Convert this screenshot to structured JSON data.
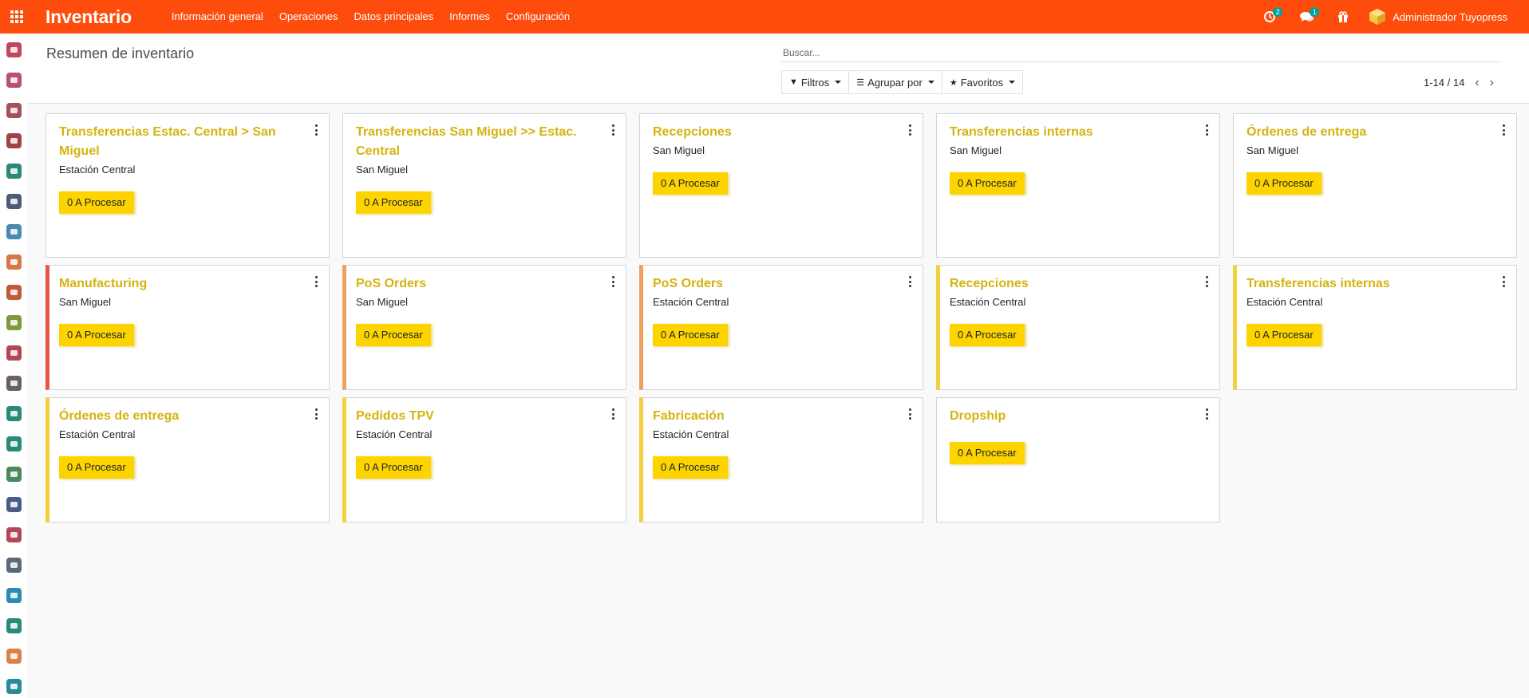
{
  "navbar": {
    "app_title": "Inventario",
    "menu": [
      "Información general",
      "Operaciones",
      "Datos principales",
      "Informes",
      "Configuración"
    ],
    "activity_badge": "2",
    "messages_badge": "1",
    "user_name": "Administrador Tuyopress",
    "color": "#fd4c0b"
  },
  "sidebar": {
    "icons": [
      {
        "name": "discuss-icon",
        "color": "#c0475e"
      },
      {
        "name": "gift-icon",
        "color": "#b7536e"
      },
      {
        "name": "chart-icon",
        "color": "#a6505c"
      },
      {
        "name": "inventory-icon",
        "color": "#a3414a"
      },
      {
        "name": "contacts-icon",
        "color": "#2a8a79"
      },
      {
        "name": "crm-icon",
        "color": "#4e5a7a"
      },
      {
        "name": "accounting-icon",
        "color": "#4a8ab0"
      },
      {
        "name": "invoice-icon",
        "color": "#d6784a"
      },
      {
        "name": "website-icon",
        "color": "#c25a3a"
      },
      {
        "name": "calendar-icon",
        "color": "#7f9a3a"
      },
      {
        "name": "delivery-icon",
        "color": "#b3475a"
      },
      {
        "name": "pos-icon",
        "color": "#6b5f6b"
      },
      {
        "name": "employees-icon",
        "color": "#2a8a79"
      },
      {
        "name": "settings-icon",
        "color": "#2a8a79"
      },
      {
        "name": "manufacturing-icon",
        "color": "#4a8a5a"
      },
      {
        "name": "apps-icon",
        "color": "#4a5a8a"
      },
      {
        "name": "timesheet-icon",
        "color": "#b3475a"
      },
      {
        "name": "email-marketing-icon",
        "color": "#5a6a7a"
      },
      {
        "name": "documents-icon",
        "color": "#2a8ab0"
      },
      {
        "name": "sales-icon",
        "color": "#2a8a79"
      },
      {
        "name": "survey-icon",
        "color": "#d6844a"
      },
      {
        "name": "team-icon",
        "color": "#2a8a9a"
      }
    ]
  },
  "control": {
    "title": "Resumen de inventario",
    "search_placeholder": "Buscar...",
    "filters_label": "Filtros",
    "groupby_label": "Agrupar por",
    "favorites_label": "Favoritos",
    "pager": "1-14 / 14"
  },
  "cards": [
    {
      "title": "Transferencias Estac. Central > San Miguel",
      "subtitle": "Estación Central",
      "button": "0 A Procesar",
      "bar": "none",
      "has_menu": true
    },
    {
      "title": "Transferencias San Miguel >> Estac. Central",
      "subtitle": "San Miguel",
      "button": "0 A Procesar",
      "bar": "none",
      "has_menu": true
    },
    {
      "title": "Recepciones",
      "subtitle": "San Miguel",
      "button": "0 A Procesar",
      "bar": "none",
      "has_menu": true
    },
    {
      "title": "Transferencias internas",
      "subtitle": "San Miguel",
      "button": "0 A Procesar",
      "bar": "none",
      "has_menu": true
    },
    {
      "title": "Órdenes de entrega",
      "subtitle": "San Miguel",
      "button": "0 A Procesar",
      "bar": "none",
      "has_menu": true
    },
    {
      "title": "Manufacturing",
      "subtitle": "San Miguel",
      "button": "0 A Procesar",
      "bar": "red",
      "has_menu": true
    },
    {
      "title": "PoS Orders",
      "subtitle": "San Miguel",
      "button": "0 A Procesar",
      "bar": "orange",
      "has_menu": true
    },
    {
      "title": "PoS Orders",
      "subtitle": "Estación Central",
      "button": "0 A Procesar",
      "bar": "orange",
      "has_menu": true
    },
    {
      "title": "Recepciones",
      "subtitle": "Estación Central",
      "button": "0 A Procesar",
      "bar": "yellow",
      "has_menu": true
    },
    {
      "title": "Transferencias internas",
      "subtitle": "Estación Central",
      "button": "0 A Procesar",
      "bar": "yellow",
      "has_menu": true
    },
    {
      "title": "Órdenes de entrega",
      "subtitle": "Estación Central",
      "button": "0 A Procesar",
      "bar": "yellow",
      "has_menu": true
    },
    {
      "title": "Pedidos TPV",
      "subtitle": "Estación Central",
      "button": "0 A Procesar",
      "bar": "yellow",
      "has_menu": true
    },
    {
      "title": "Fabricación",
      "subtitle": "Estación Central",
      "button": "0 A Procesar",
      "bar": "yellow",
      "has_menu": true
    },
    {
      "title": "Dropship",
      "subtitle": "",
      "button": "0 A Procesar",
      "bar": "none",
      "has_menu": true
    }
  ]
}
